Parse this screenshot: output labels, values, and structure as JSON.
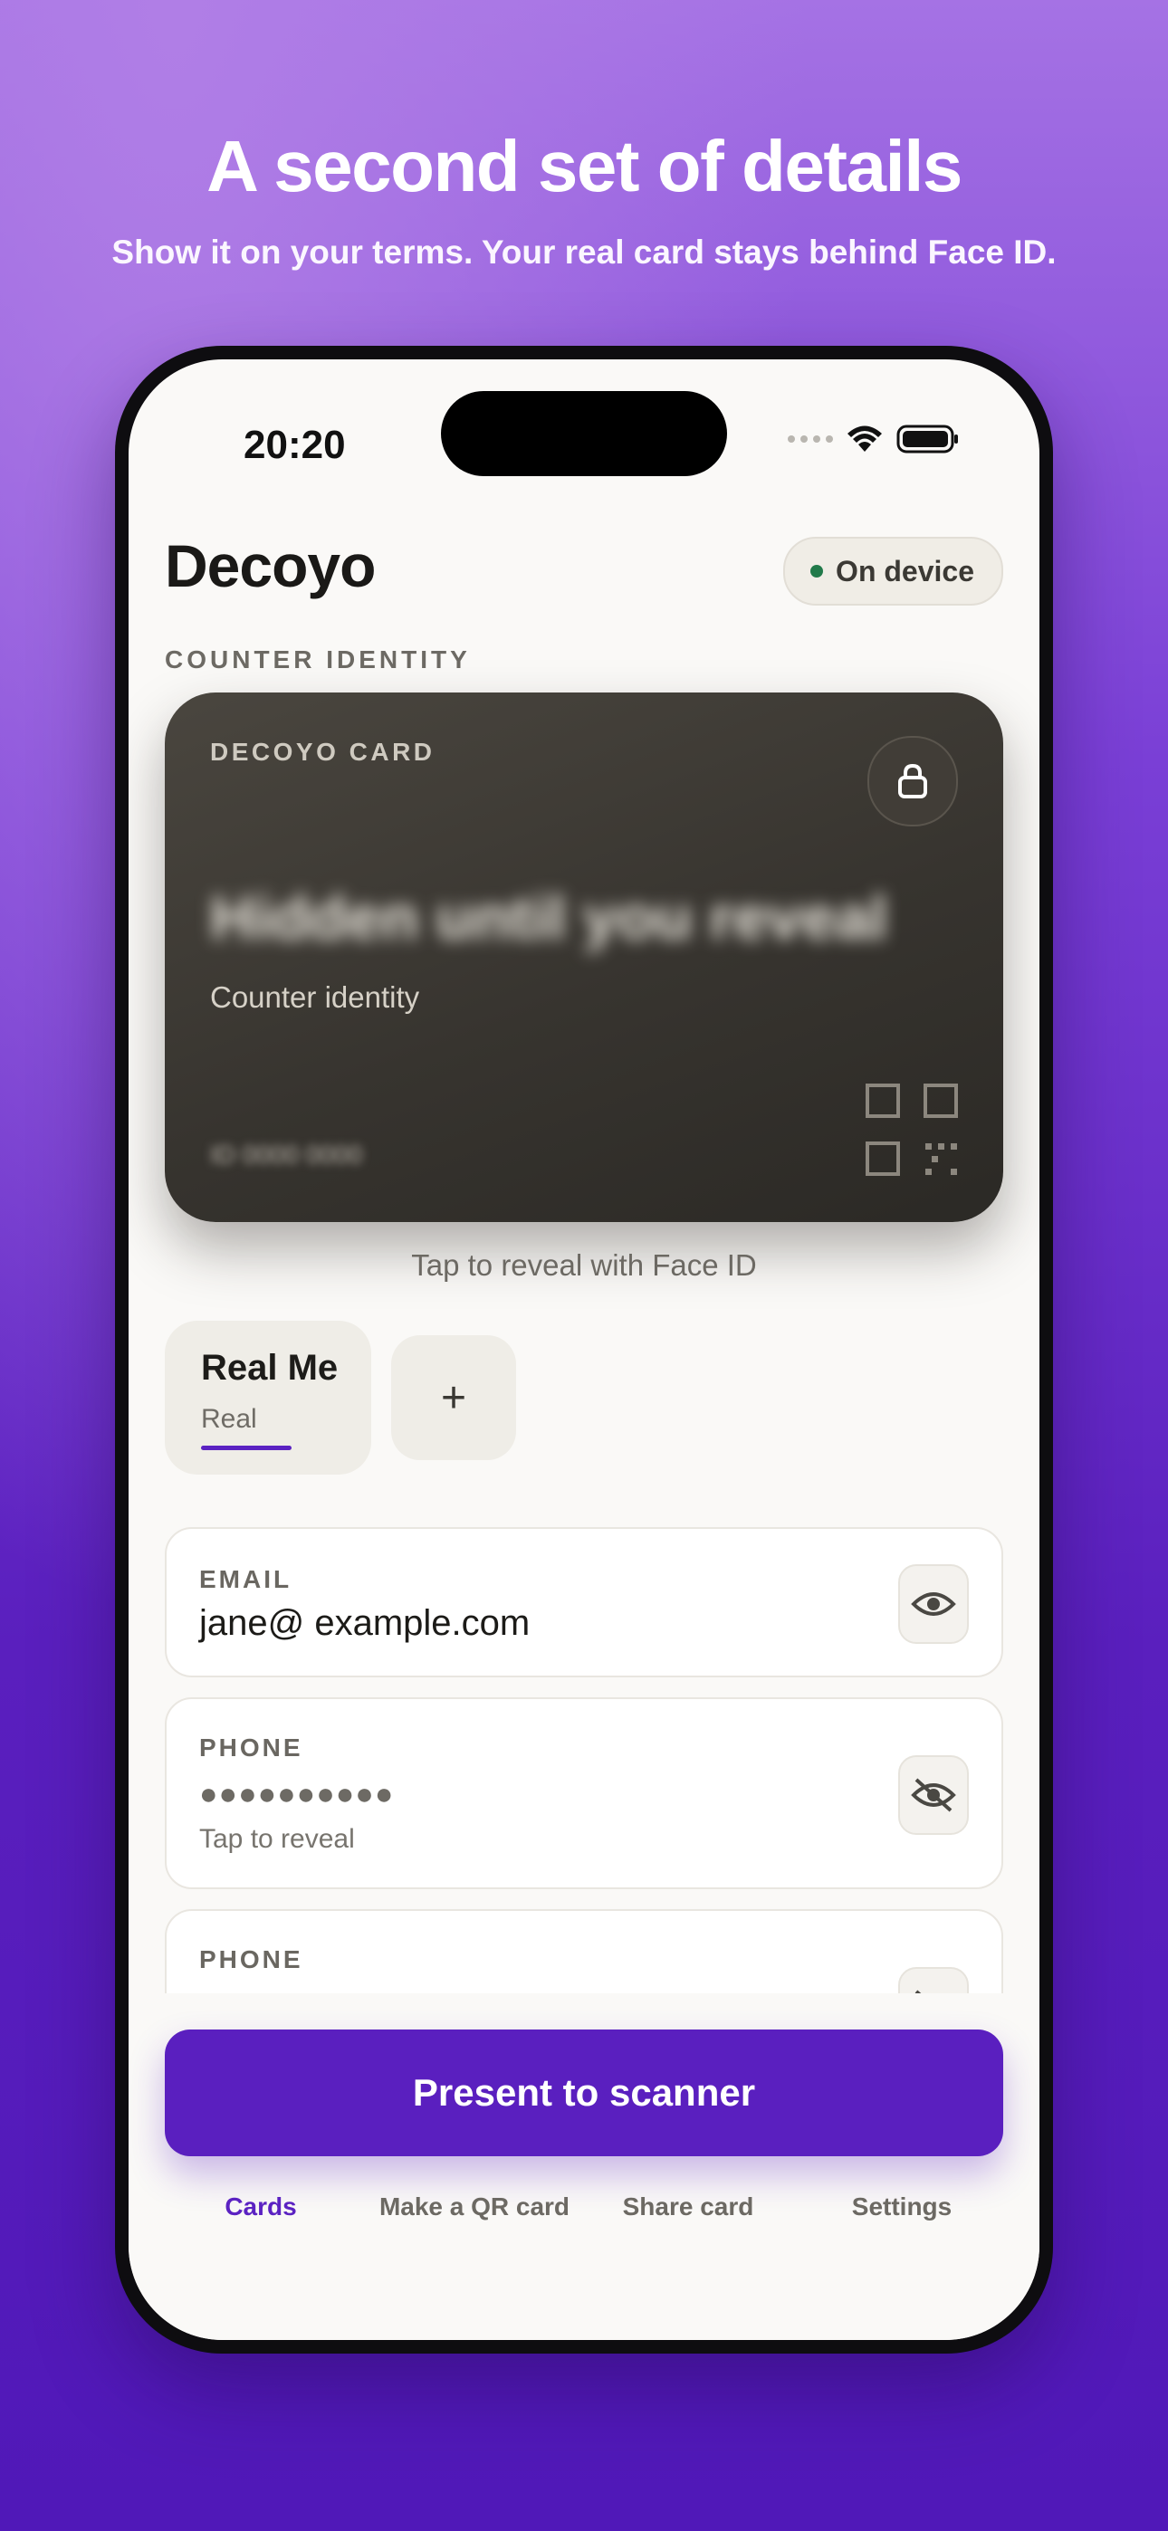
{
  "marketing": {
    "headline": "A second set of details",
    "subheadline": "Show it on your terms. Your real card stays behind Face ID."
  },
  "status_bar": {
    "time": "20:20",
    "icons": [
      "signal-dots-icon",
      "wifi-icon",
      "battery-icon"
    ]
  },
  "app": {
    "title": "Decoyo",
    "badge": "On device",
    "badge_color": "#227a4a",
    "accent_color": "#5a1fbf"
  },
  "section_label": "COUNTER IDENTITY",
  "card": {
    "brand": "DECOYO CARD",
    "hidden_name": "Hidden until you reveal",
    "subtitle": "Counter identity",
    "hidden_small": "ID 0000 0000",
    "icons": [
      "lock-icon",
      "qr-code-icon"
    ]
  },
  "reveal_hint": "Tap to reveal with Face ID",
  "identity_tabs": [
    {
      "title": "Real Me",
      "subtitle": "Real"
    }
  ],
  "add_tab_label": "+",
  "fields": [
    {
      "label": "EMAIL",
      "value": "jane@ example.com",
      "icon": "eye-icon"
    },
    {
      "label": "PHONE",
      "value": "●●●●●●●●●●",
      "hint": "Tap to reveal",
      "icon": "eye-off-icon"
    },
    {
      "label": "PHONE",
      "value": "●●●●●●●●●●",
      "icon": "eye-off-icon"
    }
  ],
  "cta_label": "Present to scanner",
  "tabbar": [
    {
      "label": "Cards",
      "active": true
    },
    {
      "label": "Make a QR card",
      "active": false
    },
    {
      "label": "Share card",
      "active": false
    },
    {
      "label": "Settings",
      "active": false
    }
  ]
}
